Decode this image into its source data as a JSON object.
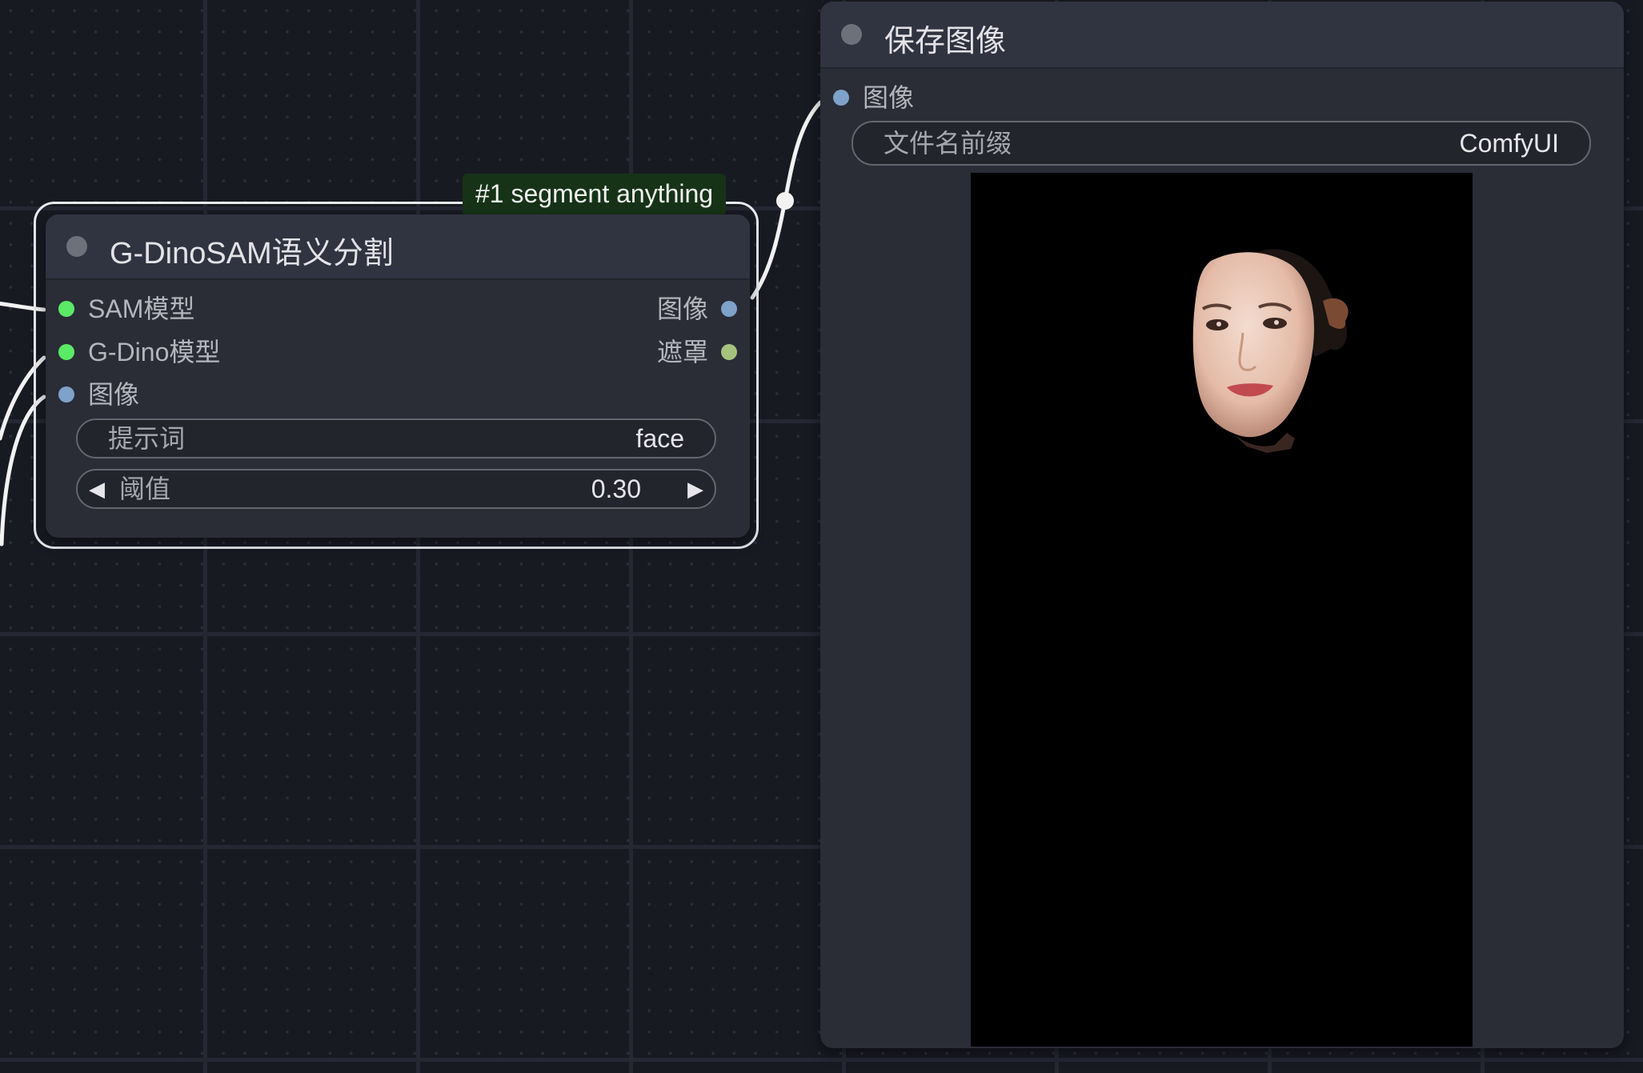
{
  "colors": {
    "canvas_bg": "#181a22",
    "node_bg": "#2a2c36",
    "link": "#f2f2f2",
    "slot_model": "#5bea66",
    "slot_image": "#7ea2c9",
    "slot_mask": "#a6c27c",
    "group_tag_bg": "#163317"
  },
  "group_tag": {
    "label": "#1 segment anything"
  },
  "segment_node": {
    "title": "G-DinoSAM语义分割",
    "collapse_icon": "circle-dot",
    "inputs": [
      {
        "label": "SAM模型",
        "type": "model"
      },
      {
        "label": "G-Dino模型",
        "type": "model"
      },
      {
        "label": "图像",
        "type": "image"
      }
    ],
    "outputs": [
      {
        "label": "图像",
        "type": "image"
      },
      {
        "label": "遮罩",
        "type": "mask"
      }
    ],
    "widgets": {
      "prompt": {
        "label": "提示词",
        "value": "face"
      },
      "threshold": {
        "label": "阈值",
        "value": "0.30",
        "decrement_icon": "left-triangle",
        "increment_icon": "right-triangle"
      }
    }
  },
  "save_node": {
    "title": "保存图像",
    "collapse_icon": "circle-dot",
    "inputs": [
      {
        "label": "图像",
        "type": "image"
      }
    ],
    "widgets": {
      "filename_prefix": {
        "label": "文件名前缀",
        "value": "ComfyUI"
      }
    },
    "preview_icon": "masked-face-image"
  }
}
